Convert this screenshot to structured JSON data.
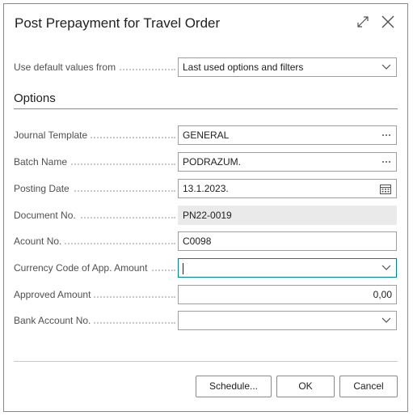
{
  "dialog": {
    "title": "Post Prepayment for Travel Order",
    "expand_icon": "expand-icon",
    "close_icon": "close-icon"
  },
  "defaults": {
    "label": "Use default values from",
    "value": "Last used options and filters"
  },
  "options": {
    "heading": "Options",
    "fields": [
      {
        "label": "Journal Template",
        "value": "GENERAL",
        "icon": "ellipsis-icon"
      },
      {
        "label": "Batch Name",
        "value": "PODRAZUM.",
        "icon": "ellipsis-icon"
      },
      {
        "label": "Posting Date",
        "value": "13.1.2023.",
        "icon": "calendar-icon"
      },
      {
        "label": "Document No.",
        "value": "PN22-0019",
        "readonly": true
      },
      {
        "label": "Acount No.",
        "value": "C0098"
      },
      {
        "label": "Currency Code of App. Amount",
        "value": "",
        "icon": "chevron-down-icon",
        "focused": true
      },
      {
        "label": "Approved Amount",
        "value": "0,00"
      },
      {
        "label": "Bank Account No.",
        "value": "",
        "icon": "chevron-down-icon"
      }
    ]
  },
  "buttons": {
    "schedule": "Schedule...",
    "ok": "OK",
    "cancel": "Cancel"
  }
}
